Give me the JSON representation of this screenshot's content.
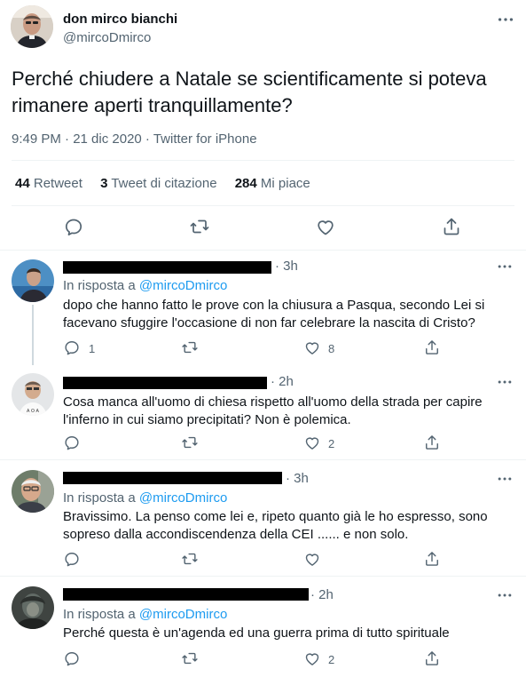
{
  "main_tweet": {
    "author_name": "don mirco bianchi",
    "author_handle": "@mircoDmirco",
    "text": "Perché chiudere a Natale se scientificamente si poteva rimanere aperti tranquillamente?",
    "meta": "9:49 PM · 21 dic 2020 · Twitter for iPhone",
    "stats": {
      "retweets_count": "44",
      "retweets_label": "Retweet",
      "quotes_count": "3",
      "quotes_label": "Tweet di citazione",
      "likes_count": "284",
      "likes_label": "Mi piace"
    }
  },
  "replies": [
    {
      "time": "· 3h",
      "in_reply_prefix": "In risposta a",
      "in_reply_mention": "@mircoDmirco",
      "text": "dopo che hanno fatto le prove con la chiusura a Pasqua, secondo Lei si facevano sfuggire l'occasione di non far  celebrare la nascita di Cristo?",
      "reply_count": "1",
      "retweet_count": "",
      "like_count": "8"
    },
    {
      "time": "· 2h",
      "text": "Cosa manca all'uomo di chiesa rispetto all'uomo della strada per capire l'inferno in cui siamo precipitati? Non è polemica.",
      "reply_count": "",
      "retweet_count": "",
      "like_count": "2"
    },
    {
      "time": "· 3h",
      "in_reply_prefix": "In risposta a",
      "in_reply_mention": "@mircoDmirco",
      "text": "Bravissimo. La penso come lei e, ripeto quanto già le ho espresso, sono sopreso dalla accondiscendenza della CEI    ......   e non solo.",
      "reply_count": "",
      "retweet_count": "",
      "like_count": ""
    },
    {
      "time": "· 2h",
      "in_reply_prefix": "In risposta a",
      "in_reply_mention": "@mircoDmirco",
      "text": "Perché questa è un'agenda ed una guerra prima di tutto spirituale",
      "reply_count": "",
      "retweet_count": "",
      "like_count": "2"
    }
  ],
  "icons": {
    "more": "more-icon",
    "reply": "reply-icon",
    "retweet": "retweet-icon",
    "like": "like-icon",
    "share": "share-icon"
  },
  "colors": {
    "text": "#0f1419",
    "secondary": "#536471",
    "mention": "#1d9bf0",
    "divider": "#eff3f4"
  }
}
